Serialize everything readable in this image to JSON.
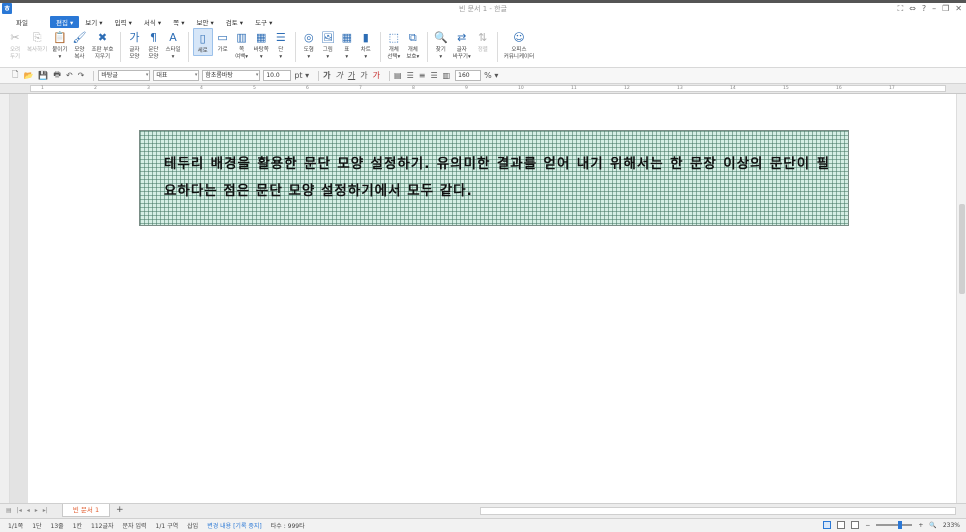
{
  "window": {
    "title": "빈 문서 1 - 한글",
    "controls": [
      "⛶",
      "⇔",
      "?",
      "–",
      "❐",
      "✕"
    ]
  },
  "app": {
    "logo": "ㅎ"
  },
  "menu": {
    "file": "파일",
    "items": [
      "편집 ▾",
      "보기 ▾",
      "입력 ▾",
      "서식 ▾",
      "쪽 ▾",
      "보안 ▾",
      "검토 ▾",
      "도구 ▾"
    ],
    "active_index": 0
  },
  "ribbon": {
    "groups": [
      [
        {
          "icon": "scissors-icon",
          "glyph": "✂",
          "label": "오려\n두기",
          "disabled": true
        },
        {
          "icon": "copy-icon",
          "glyph": "⎘",
          "label": "복사하기",
          "disabled": true
        },
        {
          "icon": "paste-icon",
          "glyph": "📋",
          "label": "붙이기\n▾"
        },
        {
          "icon": "format-copy-icon",
          "glyph": "🖌",
          "label": "모양\n복사"
        },
        {
          "icon": "clear-format-icon",
          "glyph": "✖",
          "label": "조판 부호\n지우기"
        }
      ],
      [
        {
          "icon": "char-shape-icon",
          "glyph": "가",
          "label": "글자\n모양"
        },
        {
          "icon": "para-shape-icon",
          "glyph": "¶",
          "label": "문단\n모양"
        },
        {
          "icon": "style-icon",
          "glyph": "A",
          "label": "스타일\n▾"
        }
      ],
      [
        {
          "icon": "portrait-icon",
          "glyph": "▯",
          "label": "세로",
          "selected": true
        },
        {
          "icon": "landscape-icon",
          "glyph": "▭",
          "label": "가로"
        },
        {
          "icon": "margin-icon",
          "glyph": "▥",
          "label": "쪽\n여백▾"
        },
        {
          "icon": "page-border-icon",
          "glyph": "▦",
          "label": "바탕쪽\n▾"
        },
        {
          "icon": "column-icon",
          "glyph": "☰",
          "label": "단\n▾"
        }
      ],
      [
        {
          "icon": "shape-icon",
          "glyph": "◎",
          "label": "도형\n▾"
        },
        {
          "icon": "picture-icon",
          "glyph": "🖼",
          "label": "그림\n▾"
        },
        {
          "icon": "table-icon",
          "glyph": "▦",
          "label": "표\n▾"
        },
        {
          "icon": "chart-icon",
          "glyph": "▮",
          "label": "차트\n▾"
        }
      ],
      [
        {
          "icon": "object-select-icon",
          "glyph": "⬚",
          "label": "개체\n선택▾"
        },
        {
          "icon": "object-protect-icon",
          "glyph": "⧉",
          "label": "개체\n보호▾"
        }
      ],
      [
        {
          "icon": "find-icon",
          "glyph": "🔍",
          "label": "찾기\n▾"
        },
        {
          "icon": "replace-icon",
          "glyph": "⇄",
          "label": "글자\n바꾸기▾"
        },
        {
          "icon": "sort-icon",
          "glyph": "⇅",
          "label": "정렬",
          "disabled": true
        }
      ],
      [
        {
          "icon": "office-communicator-icon",
          "glyph": "☺",
          "label": "오피스\n커뮤니케이터"
        }
      ]
    ]
  },
  "format_bar": {
    "style": "바탕글",
    "lang": "대표",
    "font": "함초롬바탕",
    "size": "10.0",
    "unit": "pt ▾",
    "line_spacing": "160",
    "percent": "% ▾"
  },
  "ruler": {
    "marks": [
      "1",
      "2",
      "3",
      "4",
      "5",
      "6",
      "7",
      "8",
      "9",
      "10",
      "11",
      "12",
      "13",
      "14",
      "15",
      "16",
      "17"
    ]
  },
  "document": {
    "paragraph": "테두리 배경을 활용한 문단 모양 설정하기. 유의미한 결과를 얻어 내기 위해서는 한 문장 이상의 문단이 필요하다는 점은 문단 모양 설정하기에서 모두 같다.",
    "border_color": "#7a8d86",
    "fill_color": "#d5eee4"
  },
  "tabs": {
    "doc_tab": "빈 문서 1",
    "add": "+"
  },
  "status": {
    "items": [
      "1/1쪽",
      "1단",
      "13줄",
      "1칸",
      "112글자",
      "문자 입력",
      "1/1 구역",
      "삽입",
      "변경 내용 [기록 중지]",
      "타수 : 999타"
    ],
    "zoom": "233%"
  }
}
